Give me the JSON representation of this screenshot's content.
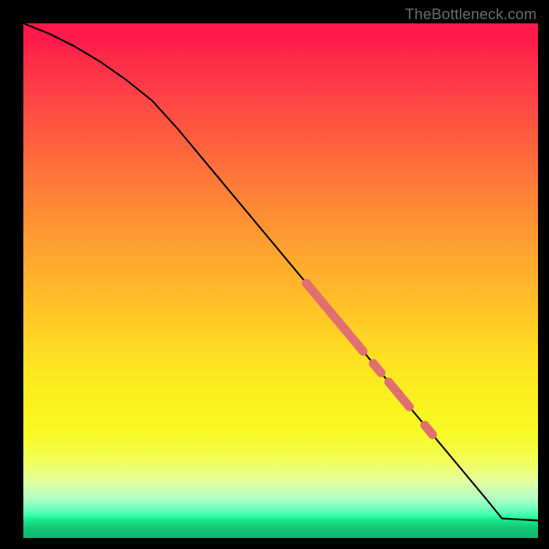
{
  "watermark": "TheBottleneck.com",
  "chart_data": {
    "type": "line",
    "title": "",
    "xlabel": "",
    "ylabel": "",
    "xlim": [
      0,
      100
    ],
    "ylim": [
      0,
      100
    ],
    "series": [
      {
        "name": "curve",
        "x": [
          0,
          5,
          10,
          15,
          20,
          25,
          30,
          35,
          40,
          45,
          50,
          55,
          60,
          65,
          70,
          75,
          80,
          85,
          90,
          93,
          100
        ],
        "y": [
          100,
          98,
          95.5,
          92.5,
          89,
          85,
          79.5,
          73.5,
          67.5,
          61.5,
          55.5,
          49.5,
          43.5,
          37.5,
          31.5,
          25.5,
          19.5,
          13.5,
          7.5,
          3.8,
          3.4
        ]
      }
    ],
    "highlights": [
      {
        "x_start": 55,
        "x_end": 66,
        "thick": true
      },
      {
        "x_start": 68,
        "x_end": 69.5,
        "thick": true
      },
      {
        "x_start": 71,
        "x_end": 75,
        "thick": true
      },
      {
        "x_start": 78,
        "x_end": 79.5,
        "thick": true
      }
    ],
    "colors": {
      "line": "#000000",
      "highlight": "#e07070",
      "gradient_top": "#ff1a4b",
      "gradient_bottom": "#10b56f"
    }
  }
}
